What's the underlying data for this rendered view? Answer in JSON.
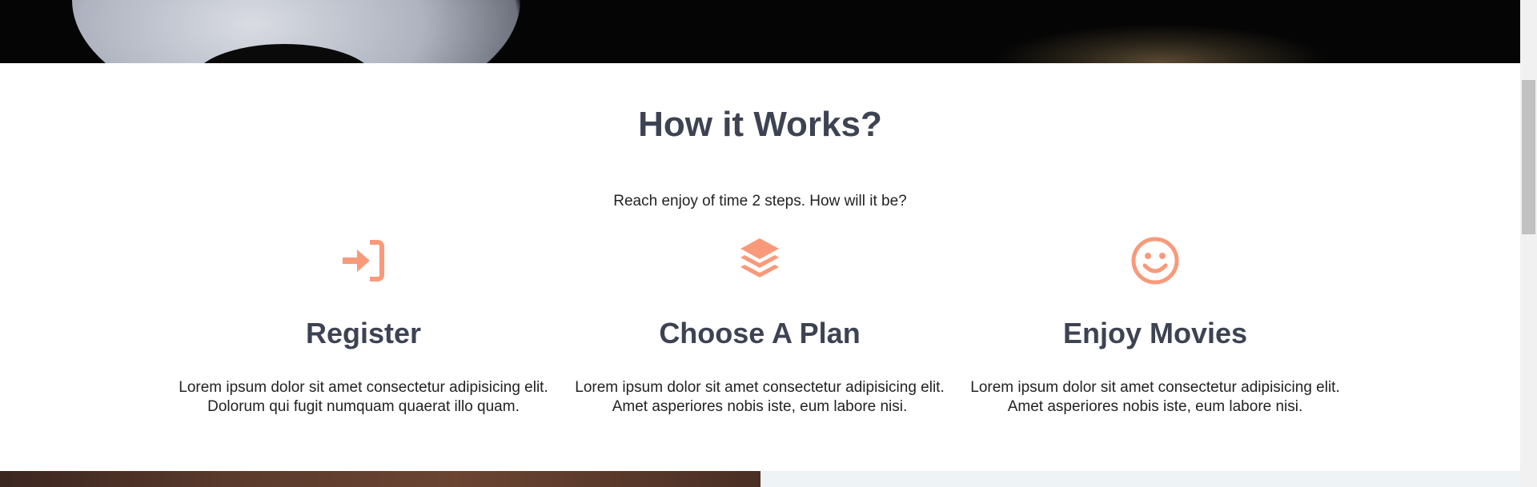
{
  "section": {
    "title": "How it Works?",
    "subtitle": "Reach enjoy of time 2 steps. How will it be?"
  },
  "steps": [
    {
      "icon": "sign-in-icon",
      "title": "Register",
      "text_line1": "Lorem ipsum dolor sit amet consectetur adipisicing elit.",
      "text_line2": "Dolorum qui fugit numquam quaerat illo quam."
    },
    {
      "icon": "layers-icon",
      "title": "Choose A Plan",
      "text_line1": "Lorem ipsum dolor sit amet consectetur adipisicing elit.",
      "text_line2": "Amet asperiores nobis iste, eum labore nisi."
    },
    {
      "icon": "smile-icon",
      "title": "Enjoy Movies",
      "text_line1": "Lorem ipsum dolor sit amet consectetur adipisicing elit.",
      "text_line2": "Amet asperiores nobis iste, eum labore nisi."
    }
  ],
  "colors": {
    "accent": "#f89a7a",
    "heading": "#3d4352",
    "body_text": "#222222"
  }
}
